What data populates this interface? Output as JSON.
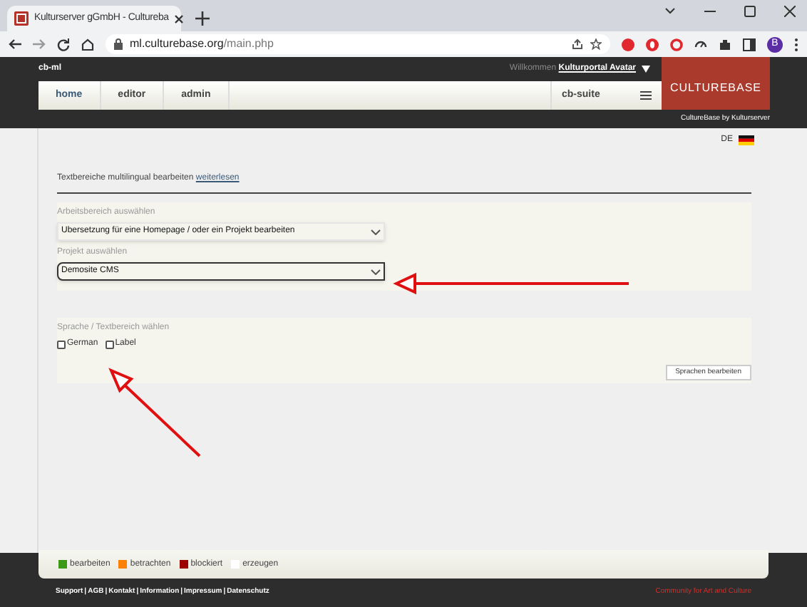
{
  "browser": {
    "tab_title": "Kulturserver gGmbH - Cultureba",
    "url_host": "ml.culturebase.org",
    "url_path": "/main.php",
    "profile": "B"
  },
  "header": {
    "app": "cb-ml",
    "welcome": "Willkommen",
    "user": "Kulturportal Avatar",
    "logo": "CULTUREBASE",
    "tagline": "CultureBase by Kulturserver",
    "suite": "cb-suite",
    "nav": [
      {
        "label": "home",
        "selected": true
      },
      {
        "label": "editor",
        "selected": false
      },
      {
        "label": "admin",
        "selected": false
      }
    ]
  },
  "language": "DE",
  "intro": {
    "text": "Textbereiche multilingual bearbeiten",
    "link": "weiterlesen"
  },
  "workspace": {
    "label": "Arbeitsbereich auswählen",
    "value": "Ubersetzung für eine Homepage / oder ein Projekt bearbeiten"
  },
  "project": {
    "label": "Projekt auswählen",
    "value": "Demosite CMS"
  },
  "languages": {
    "label": "Sprache / Textbereich wählen",
    "options": [
      {
        "label": "German",
        "checked": false
      },
      {
        "label": "Label",
        "checked": false
      }
    ],
    "button": "Sprachen bearbeiten"
  },
  "legend": [
    {
      "label": "bearbeiten",
      "color": "#3c9a17"
    },
    {
      "label": "betrachten",
      "color": "#ff8000"
    },
    {
      "label": "blockiert",
      "color": "#9a0000"
    },
    {
      "label": "erzeugen",
      "color": "#ffffff"
    }
  ],
  "footer": {
    "separator": "|",
    "links": [
      "Support",
      "AGB",
      "Kontakt",
      "Information",
      "Impressum",
      "Datenschutz"
    ],
    "slogan": "Community for Art and Culture"
  }
}
